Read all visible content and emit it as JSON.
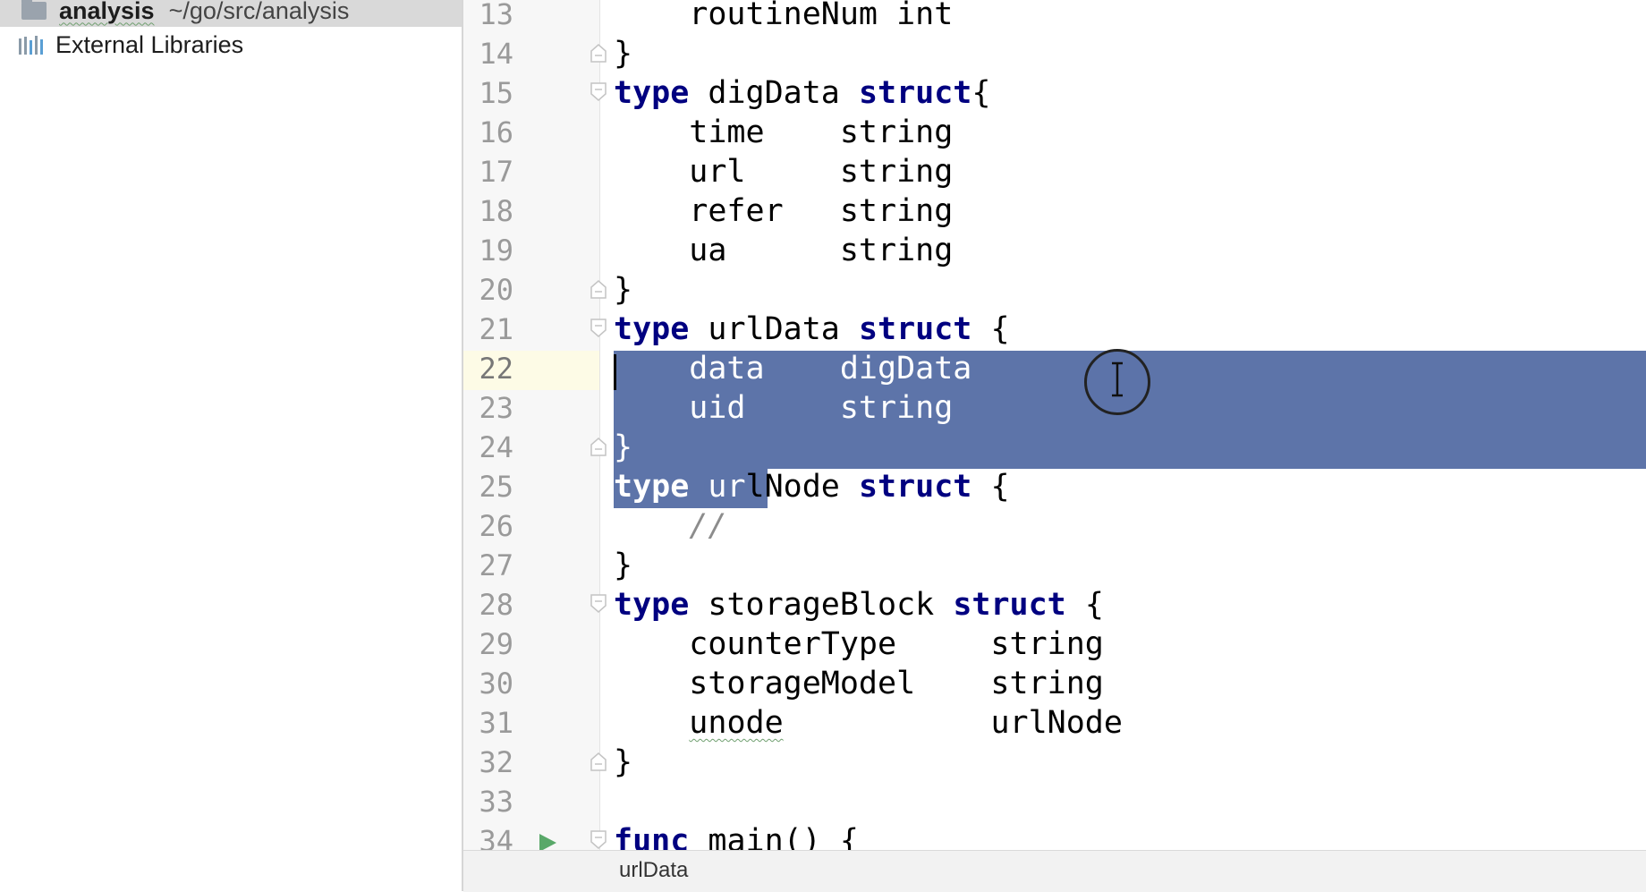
{
  "project_tree": {
    "items": [
      {
        "name": "analysis",
        "path": "~/go/src/analysis"
      },
      {
        "name": "External Libraries"
      }
    ]
  },
  "editor": {
    "language": "go",
    "current_line": 22,
    "lines": [
      {
        "num": "13",
        "code": "    routineNum int"
      },
      {
        "num": "14",
        "code": "}"
      },
      {
        "num": "15",
        "code": "type digData struct{"
      },
      {
        "num": "16",
        "code": "    time    string"
      },
      {
        "num": "17",
        "code": "    url     string"
      },
      {
        "num": "18",
        "code": "    refer   string"
      },
      {
        "num": "19",
        "code": "    ua      string"
      },
      {
        "num": "20",
        "code": "}"
      },
      {
        "num": "21",
        "code": "type urlData struct {"
      },
      {
        "num": "22",
        "code": "    data    digData"
      },
      {
        "num": "23",
        "code": "    uid     string"
      },
      {
        "num": "24",
        "code": "}"
      },
      {
        "num": "25",
        "code": "type urlNode struct {"
      },
      {
        "num": "26",
        "code": "    //"
      },
      {
        "num": "27",
        "code": "}"
      },
      {
        "num": "28",
        "code": "type storageBlock struct {"
      },
      {
        "num": "29",
        "code": "    counterType     string"
      },
      {
        "num": "30",
        "code": "    storageModel    string"
      },
      {
        "num": "31",
        "code": "    unode           urlNode"
      },
      {
        "num": "32",
        "code": "}"
      },
      {
        "num": "33",
        "code": ""
      },
      {
        "num": "34",
        "code": "func main() {"
      }
    ]
  },
  "breadcrumb": {
    "item": "urlData"
  },
  "colors": {
    "keyword": "#000080",
    "selection": "#5d74a9",
    "line_number": "#9a9a9a",
    "current_line": "#fdfbe6",
    "run_icon": "#59a869"
  },
  "icons": [
    "folder-icon",
    "library-icon",
    "fold-icon",
    "run-icon",
    "text-cursor-icon"
  ]
}
